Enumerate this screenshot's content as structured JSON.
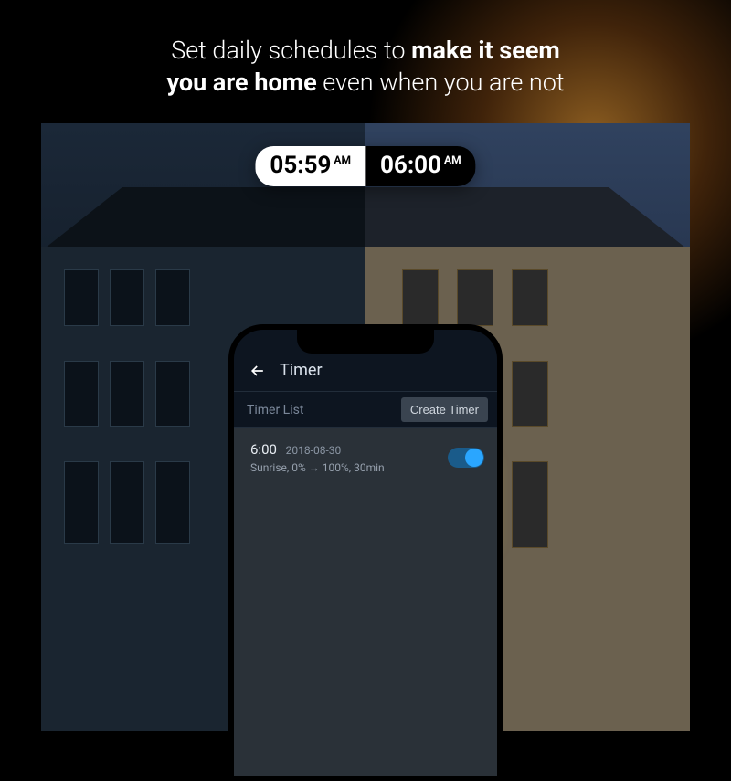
{
  "headline": {
    "part1": "Set daily schedules to ",
    "bold1": "make it seem",
    "part2": "you are home",
    "part3": " even when you are not"
  },
  "timePill": {
    "leftTime": "05:59",
    "leftAmPm": "AM",
    "rightTime": "06:00",
    "rightAmPm": "AM"
  },
  "app": {
    "title": "Timer",
    "listLabel": "Timer List",
    "createButton": "Create Timer",
    "items": [
      {
        "time": "6:00",
        "date": "2018-08-30",
        "detail": "Sunrise, 0% → 100%, 30min",
        "enabled": true
      }
    ]
  }
}
